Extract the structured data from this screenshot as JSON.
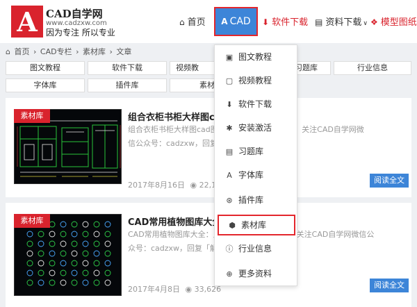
{
  "header": {
    "logo_letter": "A",
    "brand": "CAD自学网",
    "url": "www.cadzxw.com",
    "slogan": "因为专注 所以专业",
    "nav": {
      "home": "首页",
      "cad": "CAD",
      "software": "软件下载",
      "resources": "资料下载",
      "models": "模型图纸"
    }
  },
  "breadcrumb": [
    "首页",
    "CAD专栏",
    "素材库",
    "文章"
  ],
  "categories": [
    "图文教程",
    "软件下载",
    "视频教",
    "习题库",
    "行业信息",
    "字体库",
    "插件库",
    "素材"
  ],
  "dropdown": [
    {
      "icon": "image-icon",
      "label": "图文教程"
    },
    {
      "icon": "video-icon",
      "label": "视频教程"
    },
    {
      "icon": "download-icon",
      "label": "软件下载"
    },
    {
      "icon": "activate-icon",
      "label": "安装激活"
    },
    {
      "icon": "book-icon",
      "label": "习题库"
    },
    {
      "icon": "font-icon",
      "label": "字体库"
    },
    {
      "icon": "plugin-icon",
      "label": "插件库"
    },
    {
      "icon": "cube-icon",
      "label": "素材库"
    },
    {
      "icon": "info-icon",
      "label": "行业信息"
    },
    {
      "icon": "plus-icon",
      "label": "更多资料"
    }
  ],
  "articles": [
    {
      "tag": "素材库",
      "title": "组合衣柜书柜大样图cad图纸下载",
      "desc_line1": "组合衣柜书柜大样图cad图纸下载：54f 解压密码：关注CAD自学网微",
      "desc_line2": "信公众号：cadzxw，回复「解压密码」获取。",
      "date": "2017年8月16日",
      "views": "22,180",
      "read_label": "阅读全文"
    },
    {
      "tag": "素材库",
      "title": "CAD常用植物图库大全：点击下载",
      "desc_line1": "CAD常用植物图库大全：点击下载 2d 解压密码：关注CAD自学网微信公",
      "desc_line2": "众号：cadzxw，回复「解压密码」获取。",
      "date": "2017年4月8日",
      "views": "33,626",
      "read_label": "阅读全文"
    }
  ],
  "colors": {
    "brand_red": "#d9232d",
    "accent_blue": "#3d85d8",
    "highlight_border": "#e3262c"
  }
}
